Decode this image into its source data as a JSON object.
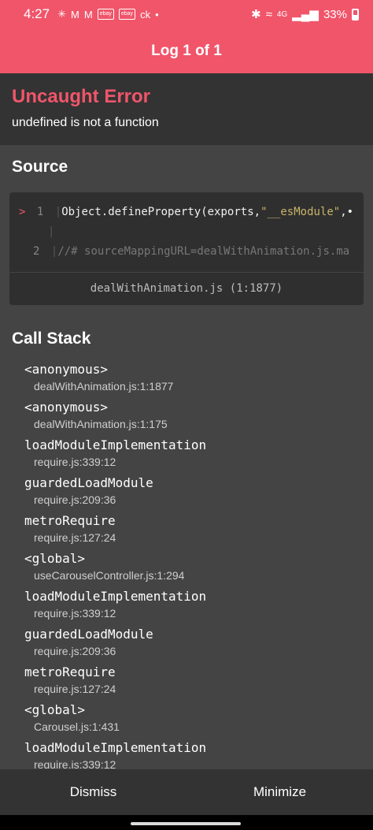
{
  "status_bar": {
    "time": "4:27",
    "carrier_text": "ck",
    "ebay_badge": "ebay",
    "signal_text": "4G",
    "battery": "33%"
  },
  "header": {
    "title": "Log 1 of 1"
  },
  "error": {
    "title": "Uncaught Error",
    "message": "undefined is not a function"
  },
  "source": {
    "heading": "Source",
    "lines": [
      {
        "marker": ">",
        "number": "1",
        "code_prefix": "Object.defineProperty(exports,",
        "code_string": "\"__esModule\"",
        "code_suffix": ",•"
      },
      {
        "marker": "",
        "number": "2",
        "code_comment": "//# sourceMappingURL=dealWithAnimation.js.ma"
      }
    ],
    "file_label": "dealWithAnimation.js (1:1877)"
  },
  "call_stack": {
    "heading": "Call Stack",
    "frames": [
      {
        "fn": "<anonymous>",
        "loc": "dealWithAnimation.js:1:1877"
      },
      {
        "fn": "<anonymous>",
        "loc": "dealWithAnimation.js:1:175"
      },
      {
        "fn": "loadModuleImplementation",
        "loc": "require.js:339:12"
      },
      {
        "fn": "guardedLoadModule",
        "loc": "require.js:209:36"
      },
      {
        "fn": "metroRequire",
        "loc": "require.js:127:24"
      },
      {
        "fn": "<global>",
        "loc": "useCarouselController.js:1:294"
      },
      {
        "fn": "loadModuleImplementation",
        "loc": "require.js:339:12"
      },
      {
        "fn": "guardedLoadModule",
        "loc": "require.js:209:36"
      },
      {
        "fn": "metroRequire",
        "loc": "require.js:127:24"
      },
      {
        "fn": "<global>",
        "loc": "Carousel.js:1:431"
      },
      {
        "fn": "loadModuleImplementation",
        "loc": "require.js:339:12"
      }
    ]
  },
  "bottom_bar": {
    "dismiss_label": "Dismiss",
    "minimize_label": "Minimize"
  },
  "colors": {
    "accent": "#f0556a",
    "panel": "#333333",
    "background": "#444444"
  }
}
